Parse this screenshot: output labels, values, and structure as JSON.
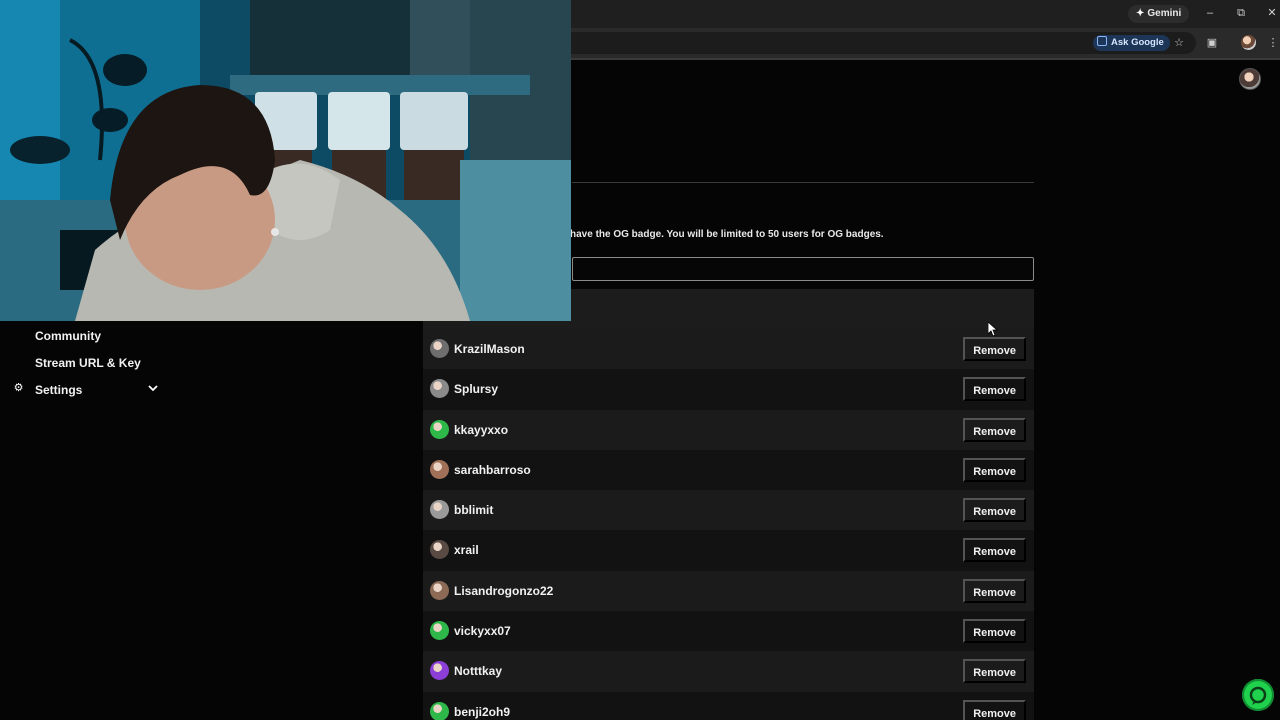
{
  "browser": {
    "gemini_label": "Gemini",
    "ask_google_label": "Ask Google"
  },
  "page": {
    "notice": "have the OG badge. You will be limited to 50 users for OG badges.",
    "user_input_placeholder": ""
  },
  "sidebar": {
    "items": [
      {
        "label": "Community",
        "icon": ""
      },
      {
        "label": "Stream URL & Key",
        "icon": ""
      },
      {
        "label": "Settings",
        "icon": "gear-icon"
      }
    ]
  },
  "users": [
    {
      "name": "KrazilMason",
      "avatar_color": "#6e6e6e",
      "remove_label": "Remove"
    },
    {
      "name": "Splursy",
      "avatar_color": "#8a8a8a",
      "remove_label": "Remove"
    },
    {
      "name": "kkayyxxo",
      "avatar_color": "#2fb84a",
      "remove_label": "Remove"
    },
    {
      "name": "sarahbarroso",
      "avatar_color": "#a07058",
      "remove_label": "Remove"
    },
    {
      "name": "bblimit",
      "avatar_color": "#9a9a9a",
      "remove_label": "Remove"
    },
    {
      "name": "xrail",
      "avatar_color": "#5a4a44",
      "remove_label": "Remove"
    },
    {
      "name": "Lisandrogonzo22",
      "avatar_color": "#8c6a55",
      "remove_label": "Remove"
    },
    {
      "name": "vickyxx07",
      "avatar_color": "#2fb84a",
      "remove_label": "Remove"
    },
    {
      "name": "Notttkay",
      "avatar_color": "#8b3fd6",
      "remove_label": "Remove"
    },
    {
      "name": "benji2oh9",
      "avatar_color": "#2fb84a",
      "remove_label": "Remove"
    }
  ],
  "colors": {
    "accent_green": "#1fd14c",
    "ask_google_bg": "#1d3556"
  }
}
